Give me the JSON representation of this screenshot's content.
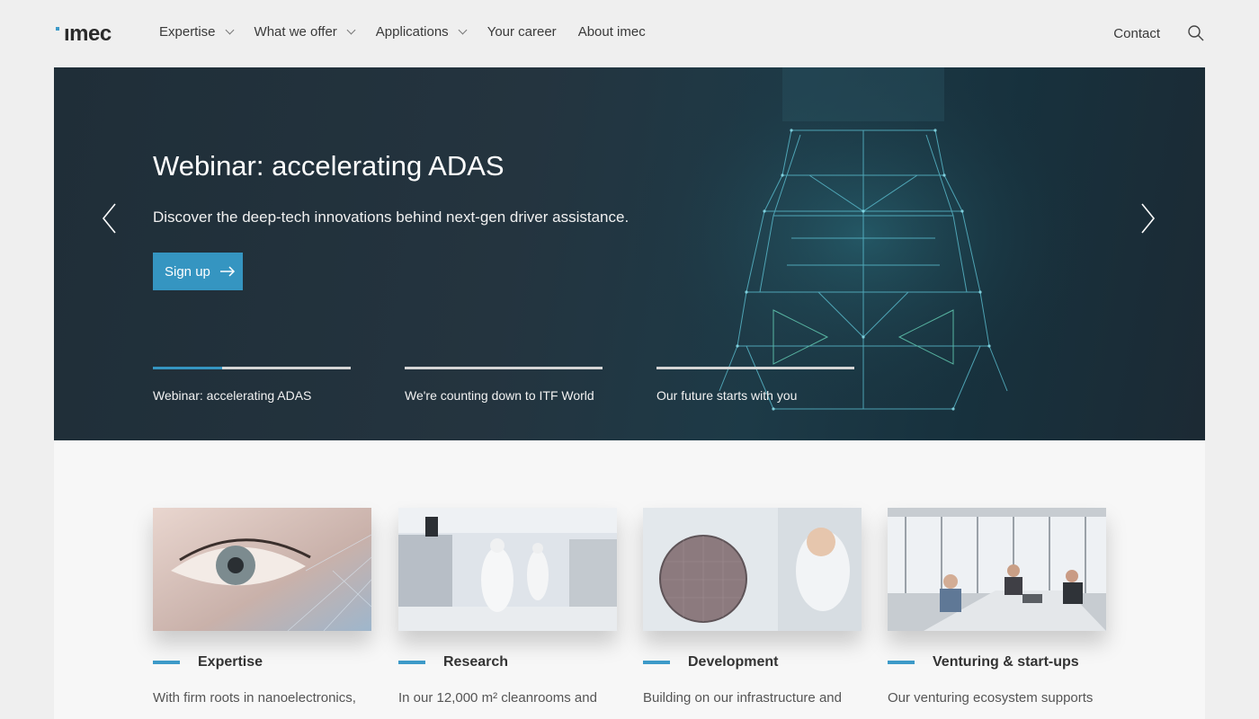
{
  "logo": {
    "text": "ımec"
  },
  "nav": {
    "items": [
      {
        "label": "Expertise",
        "has_dropdown": true
      },
      {
        "label": "What we offer",
        "has_dropdown": true
      },
      {
        "label": "Applications",
        "has_dropdown": true
      },
      {
        "label": "Your career",
        "has_dropdown": false
      },
      {
        "label": "About imec",
        "has_dropdown": false
      }
    ],
    "contact_label": "Contact",
    "search_icon": "search-icon"
  },
  "hero": {
    "title": "Webinar: accelerating ADAS",
    "subtitle": "Discover the deep-tech innovations behind next-gen driver assistance.",
    "button_label": "Sign up",
    "slides": [
      {
        "label": "Webinar: accelerating ADAS",
        "progress": 0.35
      },
      {
        "label": "We're counting down to ITF World",
        "progress": 0
      },
      {
        "label": "Our future starts with you",
        "progress": 0
      }
    ]
  },
  "cards": [
    {
      "title": "Expertise",
      "text": "With firm roots in nanoelectronics,"
    },
    {
      "title": "Research",
      "text": "In our 12,000 m² cleanrooms and"
    },
    {
      "title": "Development",
      "text": "Building on our infrastructure and"
    },
    {
      "title": "Venturing & start-ups",
      "text": "Our venturing ecosystem supports"
    }
  ],
  "colors": {
    "accent": "#3595c1",
    "hero_bg": "#1f2e38"
  }
}
